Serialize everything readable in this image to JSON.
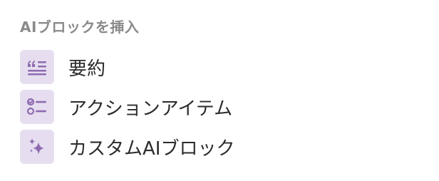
{
  "colors": {
    "icon_bg": "#e6def0",
    "icon_fg": "#8e6bb0",
    "header_text": "#8a8a8a",
    "item_text": "#2b2b2b"
  },
  "menu": {
    "header": "AIブロックを挿入",
    "items": [
      {
        "label": "要約",
        "icon": "quote-lines-icon"
      },
      {
        "label": "アクションアイテム",
        "icon": "checklist-icon"
      },
      {
        "label": "カスタムAIブロック",
        "icon": "sparkles-icon"
      }
    ]
  }
}
